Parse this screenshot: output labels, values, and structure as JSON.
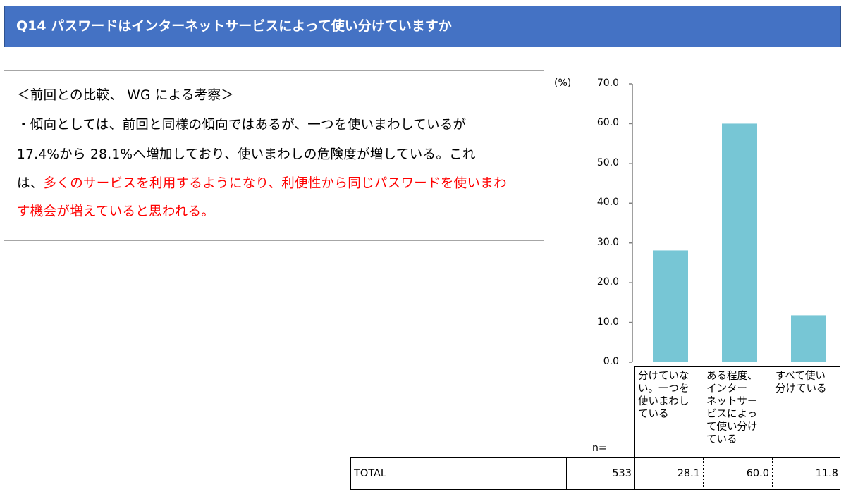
{
  "header": {
    "title": "Q14  パスワードはインターネットサービスによって使い分けていますか"
  },
  "comment": {
    "heading": "＜前回との比較、 WG による考察＞",
    "line1": "・傾向としては、前回と同様の傾向ではあるが、一つを使いまわしているが",
    "line2": "17.4%から 28.1%へ増加しており、使いまわしの危険度が増している。これ",
    "line3_black": "は、",
    "line3_red": "多くのサービスを利用するようになり、利便性から同じパスワードを使いまわ",
    "line4_red": "す機会が増えていると思われる。"
  },
  "colors": {
    "header": "#4472c4",
    "bar": "#77c6d5",
    "highlight": "#ff0000"
  },
  "chart_data": {
    "type": "bar",
    "title": "",
    "ylabel": "(%)",
    "ylim": [
      0,
      70
    ],
    "yticks": [
      "70.0",
      "60.0",
      "50.0",
      "40.0",
      "30.0",
      "20.0",
      "10.0",
      "0.0"
    ],
    "categories": [
      "分けていな\nい。一つを\n使いまわし\nている",
      "ある程度、\nインター\nネットサー\nビスによっ\nて使い分け\nている",
      "すべて使い\n分けている"
    ],
    "values": [
      28.1,
      60.0,
      11.8
    ],
    "grid": false
  },
  "table": {
    "n_label": "n=",
    "row_label": "TOTAL",
    "n": "533",
    "values": [
      "28.1",
      "60.0",
      "11.8"
    ]
  }
}
